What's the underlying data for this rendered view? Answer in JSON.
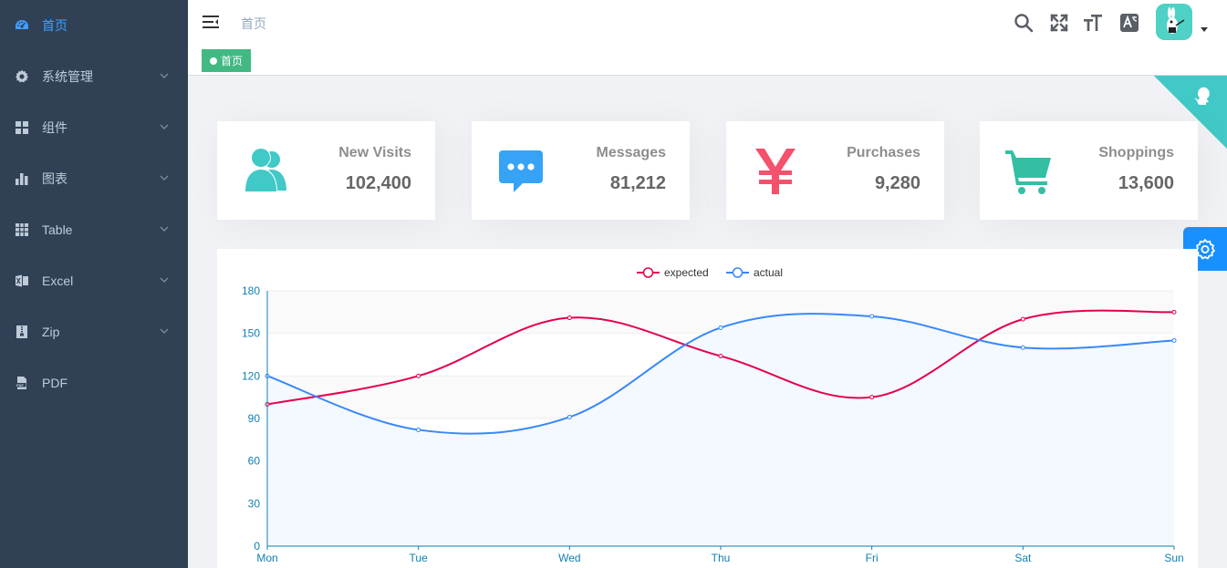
{
  "sidebar": {
    "items": [
      {
        "label": "首页",
        "icon": "dashboard-icon",
        "active": true,
        "arrow": false
      },
      {
        "label": "系统管理",
        "icon": "gear-icon",
        "active": false,
        "arrow": true
      },
      {
        "label": "组件",
        "icon": "components-icon",
        "active": false,
        "arrow": true
      },
      {
        "label": "图表",
        "icon": "bar-chart-icon",
        "active": false,
        "arrow": true
      },
      {
        "label": "Table",
        "icon": "table-icon",
        "active": false,
        "arrow": true
      },
      {
        "label": "Excel",
        "icon": "excel-icon",
        "active": false,
        "arrow": true
      },
      {
        "label": "Zip",
        "icon": "zip-icon",
        "active": false,
        "arrow": true
      },
      {
        "label": "PDF",
        "icon": "pdf-icon",
        "active": false,
        "arrow": false
      }
    ],
    "colors": {
      "background": "#304156",
      "text": "#bfcbd9",
      "active": "#409eff"
    }
  },
  "navbar": {
    "breadcrumb": "首页",
    "icons": [
      "search-icon",
      "fullscreen-icon",
      "font-size-icon",
      "translate-icon"
    ]
  },
  "tags": {
    "active_tag": "首页",
    "color": "#42b983"
  },
  "panels": [
    {
      "label": "New Visits",
      "value": "102,400",
      "icon": "people-icon",
      "color": "#40c9c6"
    },
    {
      "label": "Messages",
      "value": "81,212",
      "icon": "message-icon",
      "color": "#36a3f7"
    },
    {
      "label": "Purchases",
      "value": "9,280",
      "icon": "money-icon",
      "color": "#f4516c"
    },
    {
      "label": "Shoppings",
      "value": "13,600",
      "icon": "shopping-cart-icon",
      "color": "#34bfa3"
    }
  ],
  "chart_data": {
    "type": "line",
    "categories": [
      "Mon",
      "Tue",
      "Wed",
      "Thu",
      "Fri",
      "Sat",
      "Sun"
    ],
    "series": [
      {
        "name": "expected",
        "values": [
          100,
          120,
          161,
          134,
          105,
          160,
          165
        ],
        "color": "#e6004c",
        "area": false
      },
      {
        "name": "actual",
        "values": [
          120,
          82,
          91,
          154,
          162,
          140,
          145
        ],
        "color": "#3888fa",
        "area": true
      }
    ],
    "yticks": [
      0,
      30,
      60,
      90,
      120,
      150,
      180
    ],
    "ylim": [
      0,
      180
    ],
    "legend": "top-center",
    "grid": true
  }
}
